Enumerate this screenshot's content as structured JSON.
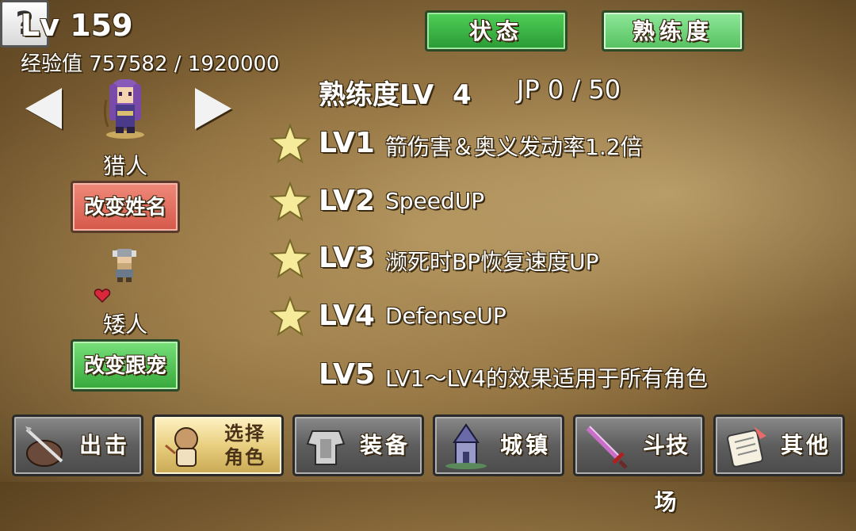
{
  "player": {
    "level": "Lv 159",
    "exp": "经验值 757582 / 1920000"
  },
  "character": {
    "job": "猎人",
    "rename_label": "改变姓名"
  },
  "pet": {
    "name": "矮人",
    "change_label": "改变跟宠"
  },
  "tabs": {
    "status": "状态",
    "proficiency": "熟练度",
    "help": "?"
  },
  "proficiency": {
    "header": "熟练度LV  4",
    "jp": "JP 0 / 50",
    "skills": [
      {
        "lv": "LV1",
        "desc": "箭伤害＆奥义发动率1.2倍",
        "unlocked": true
      },
      {
        "lv": "LV2",
        "desc": "SpeedUP",
        "unlocked": true
      },
      {
        "lv": "LV3",
        "desc": "濒死时BP恢复速度UP",
        "unlocked": true
      },
      {
        "lv": "LV4",
        "desc": "DefenseUP",
        "unlocked": true
      },
      {
        "lv": "LV5",
        "desc": "LV1～LV4的效果适用于所有角色",
        "unlocked": false
      }
    ]
  },
  "bottom_nav": [
    {
      "label": "出击",
      "icon": "bow-icon"
    },
    {
      "label": "选择角色",
      "line1": "选择",
      "line2": "角色",
      "icon": "character-select-icon",
      "active": true
    },
    {
      "label": "装备",
      "icon": "armor-icon"
    },
    {
      "label": "城镇",
      "icon": "town-icon"
    },
    {
      "label": "斗技场",
      "icon": "sword-icon"
    },
    {
      "label": "其他",
      "icon": "scroll-icon"
    }
  ],
  "colors": {
    "star": "#f5eb9a",
    "status_tab": "#2a9a34",
    "proficiency_tab": "#55c060",
    "rename": "#d4584a",
    "change_pet": "#36a83a"
  }
}
